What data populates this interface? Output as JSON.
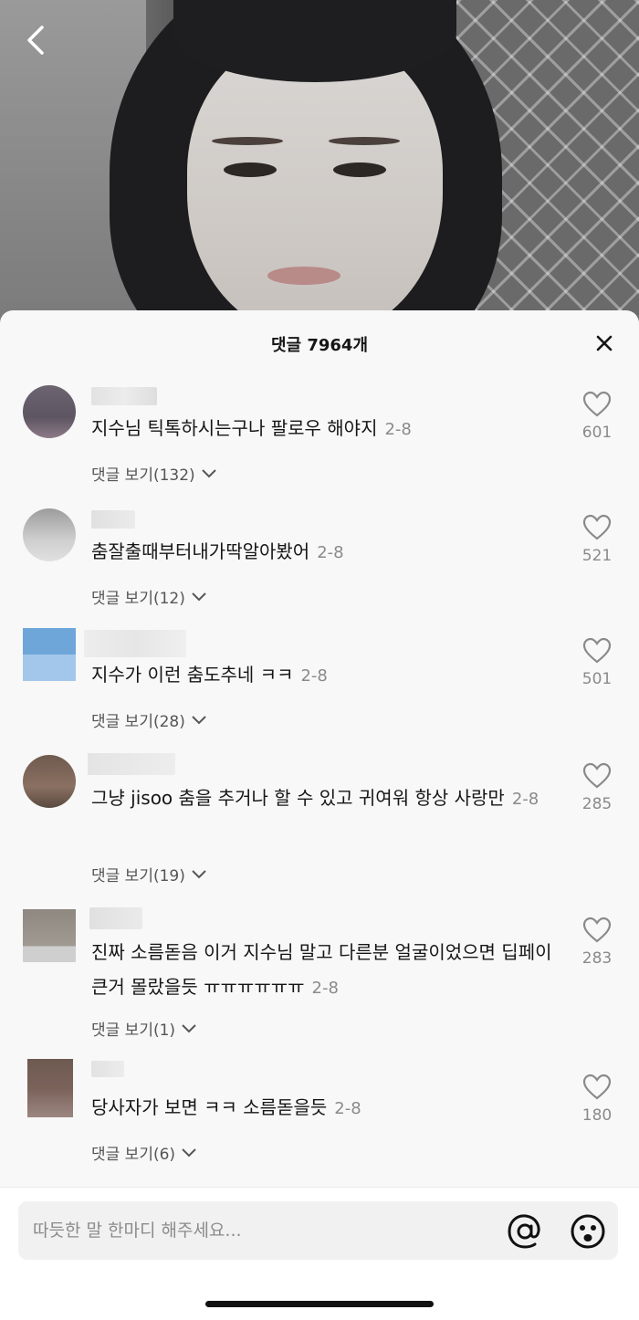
{
  "sheet": {
    "title": "댓글 7964개"
  },
  "comments": [
    {
      "text": "지수님 틱톡하시는구나 팔로우 해야지",
      "date": "2-8",
      "replies": "댓글 보기(132)",
      "likes": "601"
    },
    {
      "text": "춤잘출때부터내가딱알아봤어",
      "date": "2-8",
      "replies": "댓글 보기(12)",
      "likes": "521"
    },
    {
      "text": "지수가 이런 춤도추네 ㅋㅋ",
      "date": "2-8",
      "replies": "댓글 보기(28)",
      "likes": "501"
    },
    {
      "text": "그냥 jisoo 춤을 추거나 할 수 있고 귀여워 항상 사랑만",
      "date": "2-8",
      "replies": "댓글 보기(19)",
      "likes": "285"
    },
    {
      "text": "진짜 소름돋음 이거 지수님 말고 다른분 얼굴이었으면 딥페이큰거 몰랐을듯 ㅠㅠㅠㅠㅠㅠ",
      "date": "2-8",
      "replies": "댓글 보기(1)",
      "likes": "283"
    },
    {
      "text": "당사자가 보면 ㅋㅋ 소름돋을듯",
      "date": "2-8",
      "replies": "댓글 보기(6)",
      "likes": "180"
    }
  ],
  "input": {
    "placeholder": "따듯한 말 한마디 해주세요..."
  }
}
